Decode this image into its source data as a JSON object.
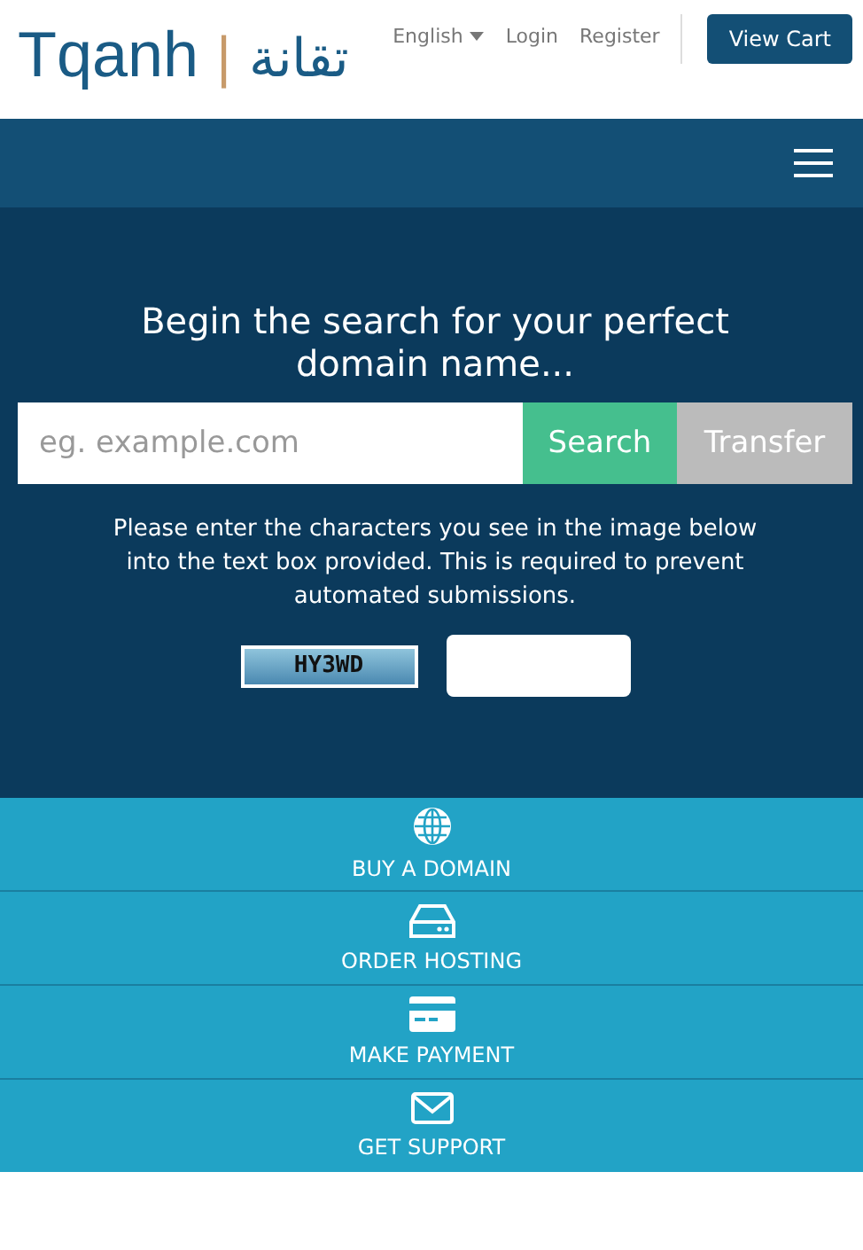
{
  "logo": {
    "latin": "Tqanh",
    "separator": "|",
    "arabic": "تقانة"
  },
  "top_links": [
    {
      "label": "English",
      "kind": "dropdown"
    },
    {
      "label": "Login",
      "kind": "link"
    },
    {
      "label": "Register",
      "kind": "link"
    }
  ],
  "cart_button": "View Cart",
  "hero": {
    "title": "Begin the search for your perfect domain name...",
    "search": {
      "placeholder": "eg. example.com"
    },
    "buttons": [
      {
        "label": "Search",
        "kind": "primary"
      },
      {
        "label": "Transfer",
        "kind": "secondary"
      }
    ],
    "captcha_note": "Please enter the characters you see in the image below into the text box provided. This is required to prevent automated submissions.",
    "captcha_code": "HY3WD"
  },
  "actions": [
    {
      "label": "BUY A DOMAIN",
      "kind": "domain"
    },
    {
      "label": "ORDER HOSTING",
      "kind": "hosting"
    },
    {
      "label": "MAKE PAYMENT",
      "kind": "payment"
    },
    {
      "label": "GET SUPPORT",
      "kind": "support"
    }
  ]
}
